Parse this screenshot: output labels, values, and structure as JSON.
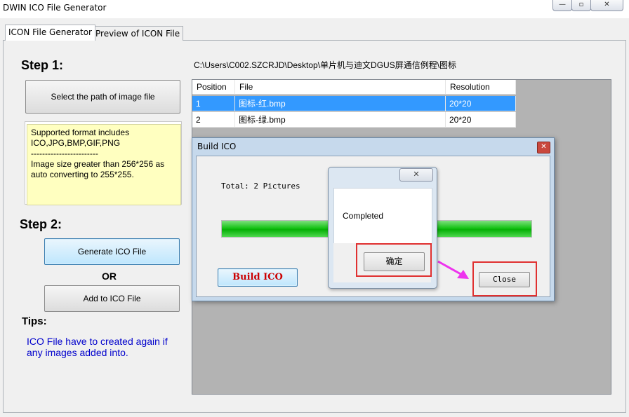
{
  "window": {
    "title": "DWIN ICO File Generator",
    "controls": [
      "—",
      "▫",
      "✕"
    ]
  },
  "tabs": [
    {
      "label": "ICON File Generator",
      "active": true
    },
    {
      "label": "Preview of ICON File",
      "active": false
    }
  ],
  "step1": {
    "heading": "Step 1:",
    "select_button": "Select the path of image file",
    "info_lines": [
      "Supported format includes",
      "ICO,JPG,BMP,GIF,PNG",
      "------------------------",
      "Image size greater than 256*256 as",
      "auto converting to 255*255."
    ]
  },
  "step2": {
    "heading": "Step 2:",
    "generate_button": "Generate ICO File",
    "or_label": "OR",
    "add_button": "Add to ICO File"
  },
  "tips": {
    "heading": "Tips:",
    "lines": [
      "ICO File have to created again if",
      "any images added into."
    ]
  },
  "path": "C:\\Users\\C002.SZCRJD\\Desktop\\单片机与迪文DGUS屏通信例程\\图标",
  "table": {
    "columns": [
      "Position",
      "File",
      "Resolution"
    ],
    "rows": [
      {
        "position": "1",
        "file": "图标-红.bmp",
        "resolution": "20*20",
        "selected": true
      },
      {
        "position": "2",
        "file": "图标-绿.bmp",
        "resolution": "20*20",
        "selected": false
      }
    ]
  },
  "build_dialog": {
    "title": "Build ICO",
    "close_glyph": "✕",
    "total_text": "Total: 2 Pictures",
    "progress": 1.0,
    "build_button": "Build ICO",
    "close_button": "Close"
  },
  "message_box": {
    "close_glyph": "✕",
    "text": "Completed",
    "ok_button": "确定"
  },
  "colors": {
    "selection": "#3399ff",
    "progress": "#17c317",
    "highlight": "#e03030",
    "annotation_arrow": "#ee33ee",
    "tips_text": "#0000cc",
    "info_background": "#ffffc0"
  }
}
